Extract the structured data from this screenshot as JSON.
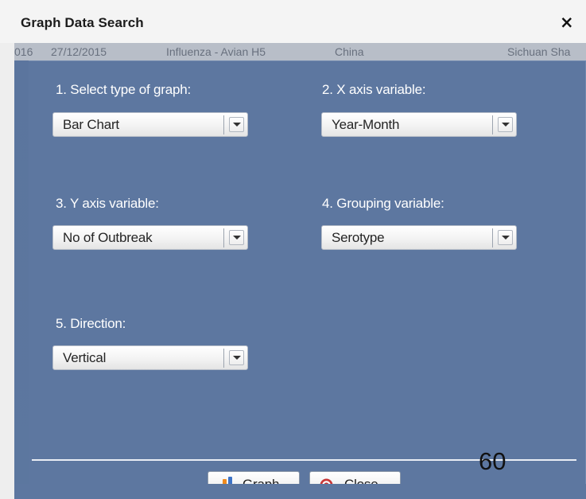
{
  "dialog": {
    "title": "Graph Data Search",
    "close_symbol": "×"
  },
  "background_row": {
    "cells": [
      "016",
      "27/12/2015",
      "Influenza - Avian H5",
      "China",
      "Sichuan Sha"
    ]
  },
  "form": {
    "graph_type": {
      "label": "1. Select type of graph:",
      "value": "Bar Chart"
    },
    "x_axis": {
      "label": "2. X axis variable:",
      "value": "Year-Month"
    },
    "y_axis": {
      "label": "3. Y axis variable:",
      "value": "No of Outbreak"
    },
    "grouping": {
      "label": "4. Grouping variable:",
      "value": "Serotype"
    },
    "direction": {
      "label": "5. Direction:",
      "value": "Vertical"
    }
  },
  "buttons": {
    "graph": "Graph",
    "close": "Close"
  },
  "slide": {
    "number": "60"
  },
  "icons": {
    "graph": "bar-chart-icon",
    "close": "close-circle-icon",
    "dropdown": "chevron-down-icon",
    "dialog_close": "close-icon"
  },
  "colors": {
    "panel": "#5d77a0",
    "graph_red": "#d52e2e",
    "graph_orange": "#f08a1c",
    "graph_blue": "#3d73c6",
    "close_red": "#c93838"
  }
}
